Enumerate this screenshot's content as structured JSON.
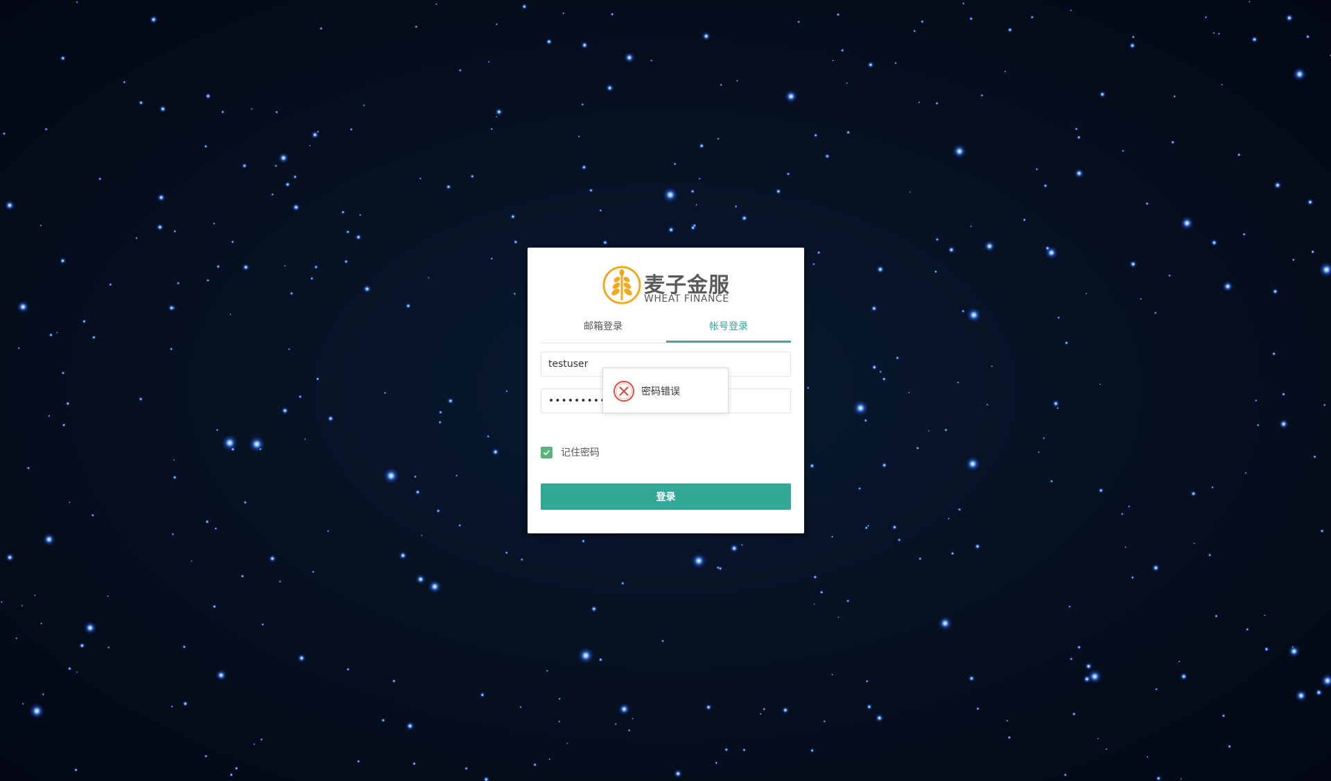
{
  "brand": {
    "name_cn": "麦子金服",
    "name_en": "WHEAT FINANCE",
    "color": "#f0a81c"
  },
  "tabs": [
    {
      "label": "邮箱登录",
      "active": false
    },
    {
      "label": "帐号登录",
      "active": true
    }
  ],
  "form": {
    "username_value": "testuser",
    "password_value": "••••••••••",
    "remember_label": "记住密码",
    "remember_checked": true,
    "submit_label": "登录"
  },
  "toast": {
    "message": "密码错误",
    "icon": "error-circle-icon"
  },
  "colors": {
    "accent": "#32a897",
    "tab_active": "#2fa596",
    "error": "#e2483d",
    "background": "#06101f"
  }
}
